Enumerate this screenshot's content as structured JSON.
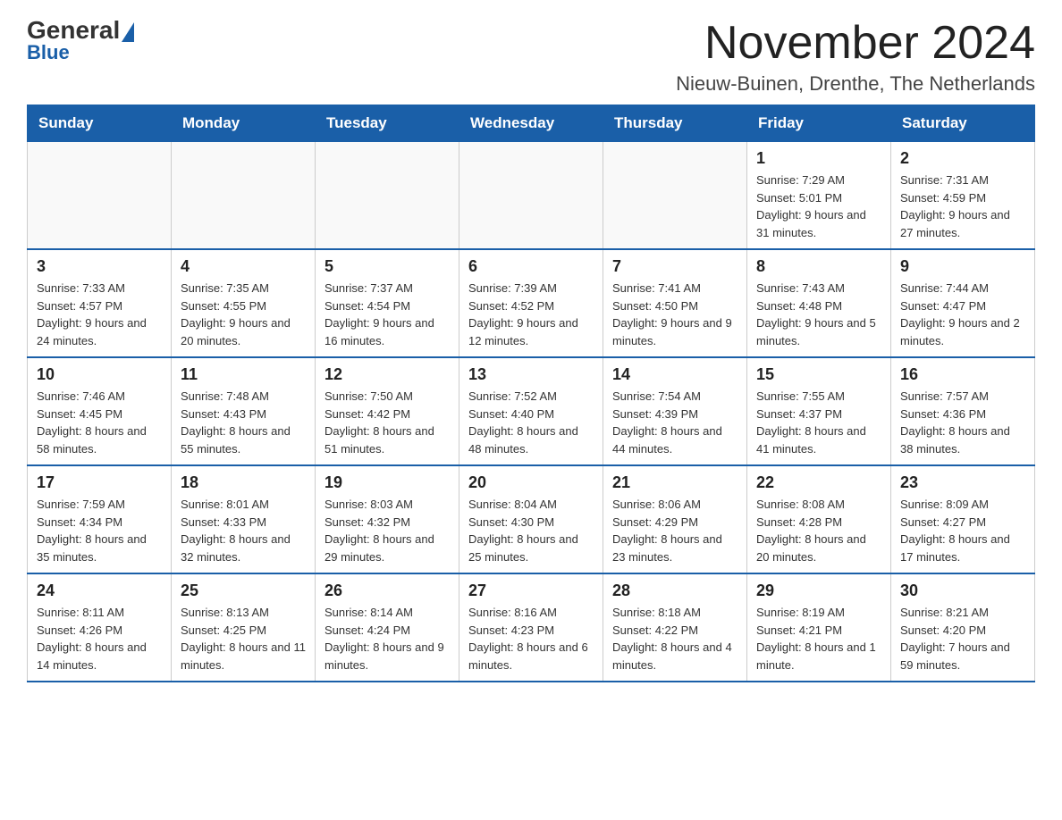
{
  "header": {
    "logo_general": "General",
    "logo_blue": "Blue",
    "month_title": "November 2024",
    "location": "Nieuw-Buinen, Drenthe, The Netherlands"
  },
  "weekdays": [
    "Sunday",
    "Monday",
    "Tuesday",
    "Wednesday",
    "Thursday",
    "Friday",
    "Saturday"
  ],
  "weeks": [
    [
      {
        "day": "",
        "info": ""
      },
      {
        "day": "",
        "info": ""
      },
      {
        "day": "",
        "info": ""
      },
      {
        "day": "",
        "info": ""
      },
      {
        "day": "",
        "info": ""
      },
      {
        "day": "1",
        "info": "Sunrise: 7:29 AM\nSunset: 5:01 PM\nDaylight: 9 hours and 31 minutes."
      },
      {
        "day": "2",
        "info": "Sunrise: 7:31 AM\nSunset: 4:59 PM\nDaylight: 9 hours and 27 minutes."
      }
    ],
    [
      {
        "day": "3",
        "info": "Sunrise: 7:33 AM\nSunset: 4:57 PM\nDaylight: 9 hours and 24 minutes."
      },
      {
        "day": "4",
        "info": "Sunrise: 7:35 AM\nSunset: 4:55 PM\nDaylight: 9 hours and 20 minutes."
      },
      {
        "day": "5",
        "info": "Sunrise: 7:37 AM\nSunset: 4:54 PM\nDaylight: 9 hours and 16 minutes."
      },
      {
        "day": "6",
        "info": "Sunrise: 7:39 AM\nSunset: 4:52 PM\nDaylight: 9 hours and 12 minutes."
      },
      {
        "day": "7",
        "info": "Sunrise: 7:41 AM\nSunset: 4:50 PM\nDaylight: 9 hours and 9 minutes."
      },
      {
        "day": "8",
        "info": "Sunrise: 7:43 AM\nSunset: 4:48 PM\nDaylight: 9 hours and 5 minutes."
      },
      {
        "day": "9",
        "info": "Sunrise: 7:44 AM\nSunset: 4:47 PM\nDaylight: 9 hours and 2 minutes."
      }
    ],
    [
      {
        "day": "10",
        "info": "Sunrise: 7:46 AM\nSunset: 4:45 PM\nDaylight: 8 hours and 58 minutes."
      },
      {
        "day": "11",
        "info": "Sunrise: 7:48 AM\nSunset: 4:43 PM\nDaylight: 8 hours and 55 minutes."
      },
      {
        "day": "12",
        "info": "Sunrise: 7:50 AM\nSunset: 4:42 PM\nDaylight: 8 hours and 51 minutes."
      },
      {
        "day": "13",
        "info": "Sunrise: 7:52 AM\nSunset: 4:40 PM\nDaylight: 8 hours and 48 minutes."
      },
      {
        "day": "14",
        "info": "Sunrise: 7:54 AM\nSunset: 4:39 PM\nDaylight: 8 hours and 44 minutes."
      },
      {
        "day": "15",
        "info": "Sunrise: 7:55 AM\nSunset: 4:37 PM\nDaylight: 8 hours and 41 minutes."
      },
      {
        "day": "16",
        "info": "Sunrise: 7:57 AM\nSunset: 4:36 PM\nDaylight: 8 hours and 38 minutes."
      }
    ],
    [
      {
        "day": "17",
        "info": "Sunrise: 7:59 AM\nSunset: 4:34 PM\nDaylight: 8 hours and 35 minutes."
      },
      {
        "day": "18",
        "info": "Sunrise: 8:01 AM\nSunset: 4:33 PM\nDaylight: 8 hours and 32 minutes."
      },
      {
        "day": "19",
        "info": "Sunrise: 8:03 AM\nSunset: 4:32 PM\nDaylight: 8 hours and 29 minutes."
      },
      {
        "day": "20",
        "info": "Sunrise: 8:04 AM\nSunset: 4:30 PM\nDaylight: 8 hours and 25 minutes."
      },
      {
        "day": "21",
        "info": "Sunrise: 8:06 AM\nSunset: 4:29 PM\nDaylight: 8 hours and 23 minutes."
      },
      {
        "day": "22",
        "info": "Sunrise: 8:08 AM\nSunset: 4:28 PM\nDaylight: 8 hours and 20 minutes."
      },
      {
        "day": "23",
        "info": "Sunrise: 8:09 AM\nSunset: 4:27 PM\nDaylight: 8 hours and 17 minutes."
      }
    ],
    [
      {
        "day": "24",
        "info": "Sunrise: 8:11 AM\nSunset: 4:26 PM\nDaylight: 8 hours and 14 minutes."
      },
      {
        "day": "25",
        "info": "Sunrise: 8:13 AM\nSunset: 4:25 PM\nDaylight: 8 hours and 11 minutes."
      },
      {
        "day": "26",
        "info": "Sunrise: 8:14 AM\nSunset: 4:24 PM\nDaylight: 8 hours and 9 minutes."
      },
      {
        "day": "27",
        "info": "Sunrise: 8:16 AM\nSunset: 4:23 PM\nDaylight: 8 hours and 6 minutes."
      },
      {
        "day": "28",
        "info": "Sunrise: 8:18 AM\nSunset: 4:22 PM\nDaylight: 8 hours and 4 minutes."
      },
      {
        "day": "29",
        "info": "Sunrise: 8:19 AM\nSunset: 4:21 PM\nDaylight: 8 hours and 1 minute."
      },
      {
        "day": "30",
        "info": "Sunrise: 8:21 AM\nSunset: 4:20 PM\nDaylight: 7 hours and 59 minutes."
      }
    ]
  ]
}
